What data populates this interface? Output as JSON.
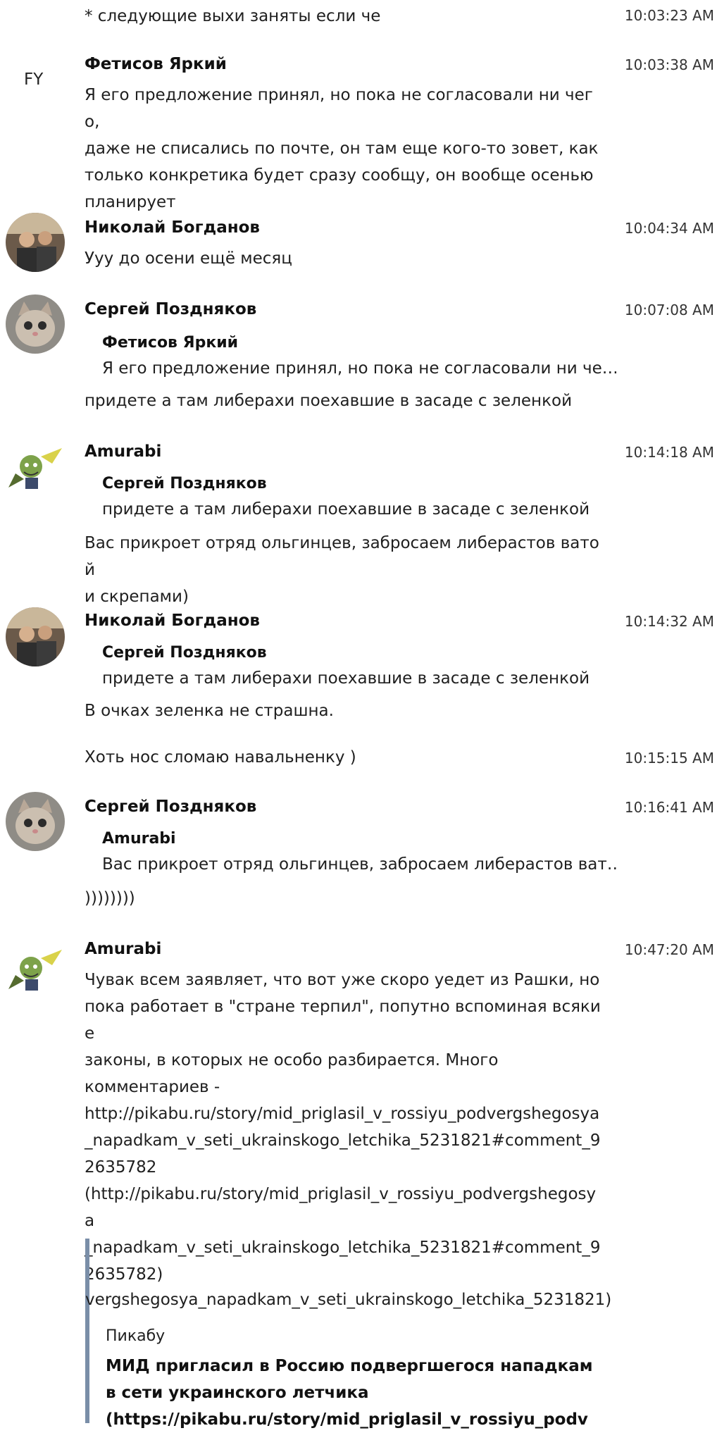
{
  "messages": [
    {
      "text": "* следующие выхи заняты если че",
      "time": "10:03:23 AM"
    },
    {
      "avatar_initials": "FY",
      "author": "Фетисов Яркий",
      "time": "10:03:38 AM",
      "text": "Я его предложение принял, но пока не согласовали ни чего,\nдаже не списались по почте, он там еще кого-то зовет, как\nтолько конкретика будет сразу сообщу, он вообще осенью\nпланирует"
    },
    {
      "author": "Николай Богданов",
      "time": "10:04:34 AM",
      "text": "Ууу до осени ещё месяц"
    },
    {
      "author": "Сергей Поздняков",
      "time": "10:07:08 AM",
      "quote": {
        "author": "Фетисов Яркий",
        "text": "Я его предложение принял, но пока не согласовали ни че…"
      },
      "text": "придете а там либерахи поехавшие в засаде с зеленкой"
    },
    {
      "author": "Amurabi",
      "time": "10:14:18 AM",
      "quote": {
        "author": "Сергей Поздняков",
        "text": "придете а там либерахи поехавшие в засаде с зеленкой"
      },
      "text": "Вас прикроет отряд ольгинцев, забросаем либерастов ватой\nи скрепами)"
    },
    {
      "author": "Николай Богданов",
      "time": "10:14:32 AM",
      "quote": {
        "author": "Сергей Поздняков",
        "text": "придете а там либерахи поехавшие в засаде с зеленкой"
      },
      "text": "В очках зеленка не страшна."
    },
    {
      "text": "Хоть нос сломаю навальненку )",
      "time": "10:15:15 AM"
    },
    {
      "author": "Сергей Поздняков",
      "time": "10:16:41 AM",
      "quote": {
        "author": "Amurabi",
        "text": "Вас прикроет отряд ольгинцев, забросаем либерастов ват…"
      },
      "text": "))))))))"
    },
    {
      "author": "Amurabi",
      "time": "10:47:20 AM",
      "text": "Чувак всем заявляет, что вот уже скоро уедет из Рашки, но\nпока работает в \"стране терпил\", попутно вспоминая всякие\nзаконы, в которых не особо разбирается. Много\nкомментариев -\nhttp://pikabu.ru/story/mid_priglasil_v_rossiyu_podvergshegosya\n_napadkam_v_seti_ukrainskogo_letchika_5231821#comment_9\n2635782\n(http://pikabu.ru/story/mid_priglasil_v_rossiyu_podvergshegosya\n_napadkam_v_seti_ukrainskogo_letchika_5231821#comment_9\n2635782)",
      "embed": {
        "clipped_url": "vergshegosya_napadkam_v_seti_ukrainskogo_letchika_5231821)",
        "site": "Пикабу",
        "title": "МИД пригласил в Россию подвергшегося нападкам\nв сети украинского летчика\n(https://pikabu.ru/story/mid_priglasil_v_rossiyu_podv"
      }
    }
  ],
  "colors": {
    "embed_bar": "#7a8ea8"
  }
}
